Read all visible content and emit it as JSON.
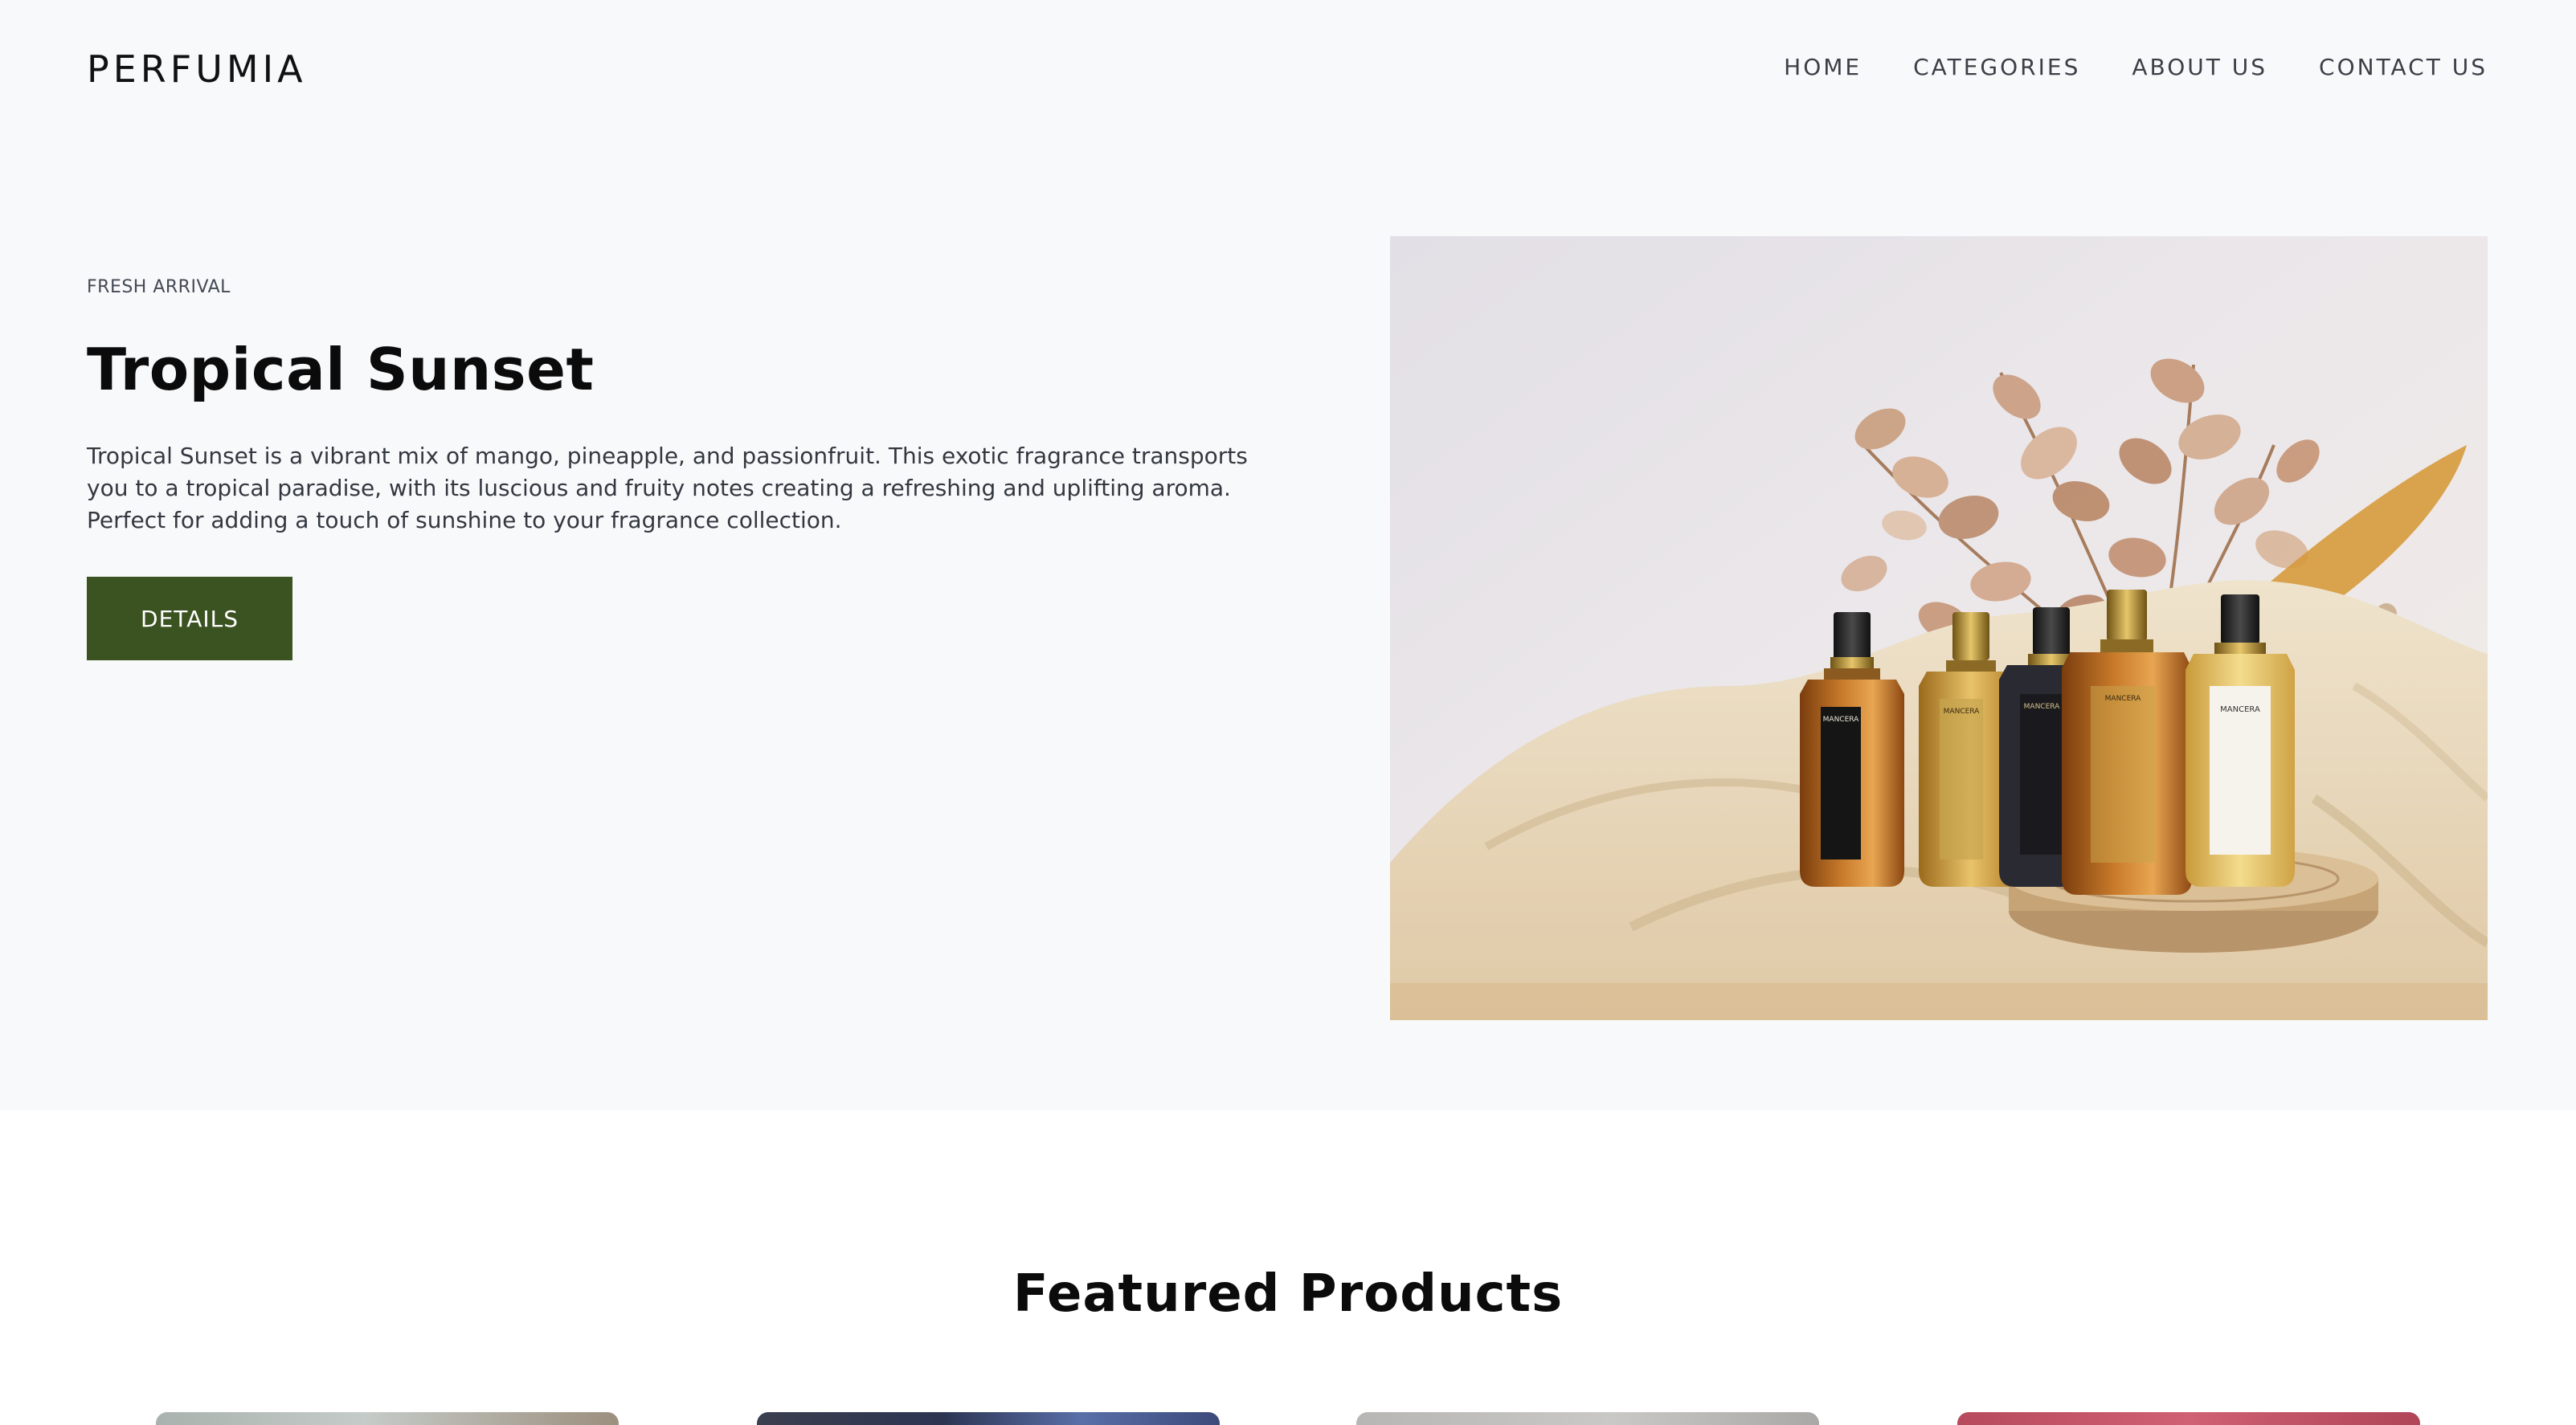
{
  "header": {
    "logo": "PERFUMIA",
    "nav": [
      {
        "label": "HOME"
      },
      {
        "label": "CATEGORIES"
      },
      {
        "label": "ABOUT US"
      },
      {
        "label": "CONTACT US"
      }
    ]
  },
  "hero": {
    "eyebrow": "FRESH ARRIVAL",
    "title": "Tropical Sunset",
    "description": "Tropical Sunset is a vibrant mix of mango, pineapple, and passionfruit. This exotic fragrance transports you to a tropical paradise, with its luscious and fruity notes creating a refreshing and uplifting aroma. Perfect for adding a touch of sunshine to your fragrance collection.",
    "button_label": "DETAILS",
    "bottle_labels": [
      "MANCERA",
      "MANCERA",
      "MANCERA",
      "MANCERA",
      "MANCERA"
    ],
    "colors": {
      "background": "#f8f9fb",
      "button": "#3b5221"
    }
  },
  "featured": {
    "title": "Featured Products",
    "cards": [
      {
        "name": "product-card-1"
      },
      {
        "name": "product-card-2"
      },
      {
        "name": "product-card-3"
      },
      {
        "name": "product-card-4"
      }
    ]
  }
}
